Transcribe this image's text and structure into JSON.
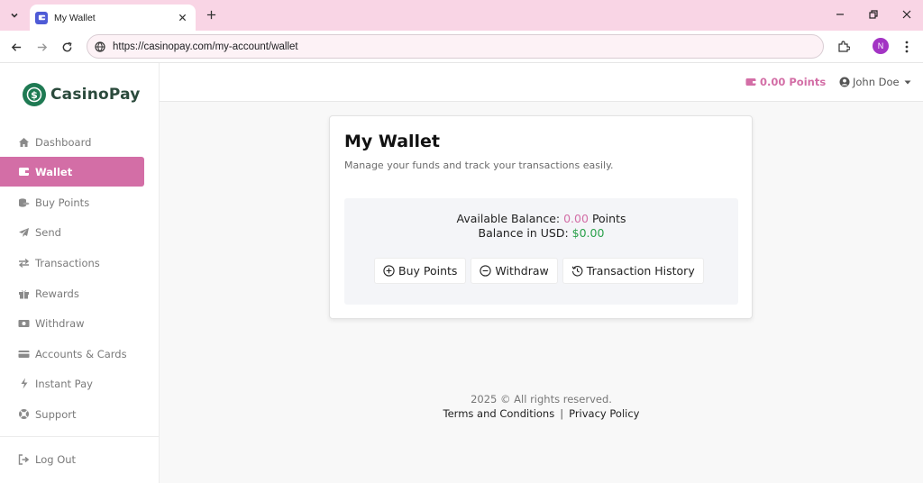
{
  "browser": {
    "tab_title": "My Wallet",
    "url": "https://casinopay.com/my-account/wallet",
    "profile_initial": "N"
  },
  "brand": {
    "name": "CasinoPay",
    "accent": "#d36ea6",
    "logo_color": "#1f7a53"
  },
  "sidebar": {
    "items": [
      {
        "label": "Dashboard",
        "icon": "home-icon"
      },
      {
        "label": "Wallet",
        "icon": "wallet-icon",
        "active": true
      },
      {
        "label": "Buy Points",
        "icon": "coins-icon"
      },
      {
        "label": "Send",
        "icon": "paper-plane-icon"
      },
      {
        "label": "Transactions",
        "icon": "exchange-icon"
      },
      {
        "label": "Rewards",
        "icon": "gift-icon"
      },
      {
        "label": "Withdraw",
        "icon": "money-bill-icon"
      },
      {
        "label": "Accounts & Cards",
        "icon": "credit-card-icon"
      },
      {
        "label": "Instant Pay",
        "icon": "bolt-icon"
      },
      {
        "label": "Support",
        "icon": "life-ring-icon"
      }
    ],
    "logout_label": "Log Out"
  },
  "header": {
    "points": "0.00 Points",
    "user_name": "John Doe"
  },
  "wallet": {
    "title": "My Wallet",
    "subtitle": "Manage your funds and track your transactions easily.",
    "available_label": "Available Balance:",
    "available_value": "0.00",
    "available_unit": "Points",
    "usd_label": "Balance in USD:",
    "usd_value": "$0.00",
    "buttons": {
      "buy": "Buy Points",
      "withdraw": "Withdraw",
      "history": "Transaction History"
    }
  },
  "footer": {
    "copyright": "2025 © All rights reserved.",
    "terms": "Terms and Conditions",
    "separator": "|",
    "privacy": "Privacy Policy"
  }
}
